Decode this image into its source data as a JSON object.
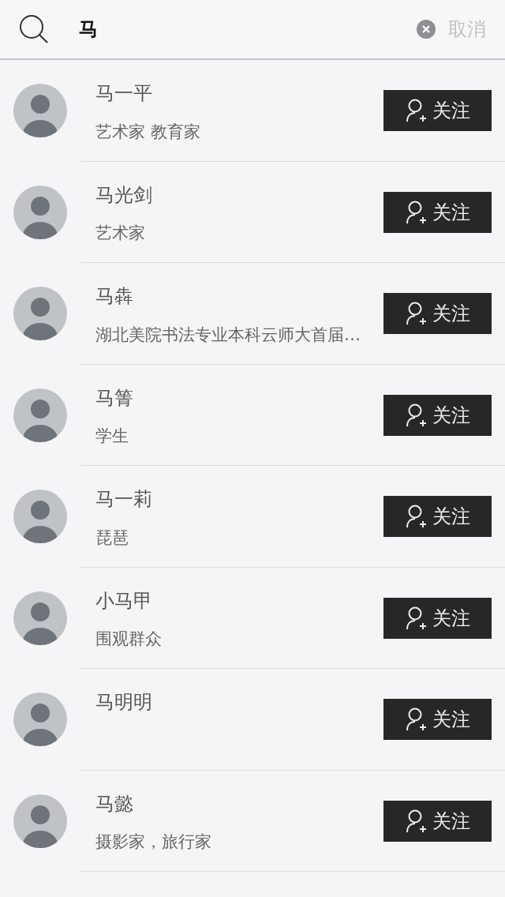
{
  "search": {
    "value": "马",
    "clear": true,
    "cancel": "取消"
  },
  "results": [
    {
      "name": "马一平",
      "description": "艺术家 教育家",
      "button": "关注"
    },
    {
      "name": "马光剑",
      "description": "艺术家",
      "button": "关注"
    },
    {
      "name": "马犇",
      "description": "湖北美院书法专业本科云师大首届…",
      "button": "关注"
    },
    {
      "name": "马箐",
      "description": "学生",
      "button": "关注"
    },
    {
      "name": "马一莉",
      "description": "琵琶",
      "button": "关注"
    },
    {
      "name": "小马甲",
      "description": "围观群众",
      "button": "关注"
    },
    {
      "name": "马明明",
      "button": "关注"
    },
    {
      "name": "马懿",
      "description": "摄影家，旅行家",
      "button": "关注"
    }
  ]
}
